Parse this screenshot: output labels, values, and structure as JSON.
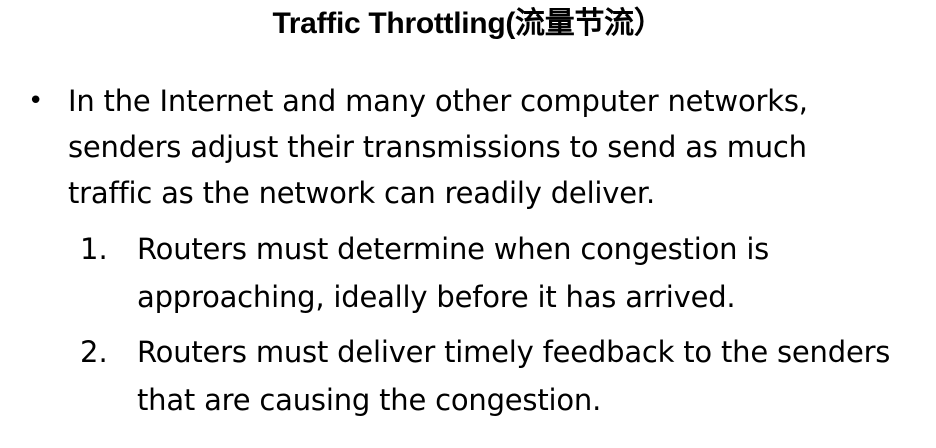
{
  "title": "Traffic Throttling(流量节流）",
  "bullet": {
    "symbol": "•",
    "text": "In the Internet and many other computer networks, senders adjust their transmissions to send as much traffic as the network can readily deliver."
  },
  "items": [
    {
      "number": "1.",
      "text": "Routers must determine when congestion is approaching, ideally before it has arrived."
    },
    {
      "number": "2.",
      "text": "Routers must deliver timely feedback to the senders that are causing the congestion."
    }
  ]
}
